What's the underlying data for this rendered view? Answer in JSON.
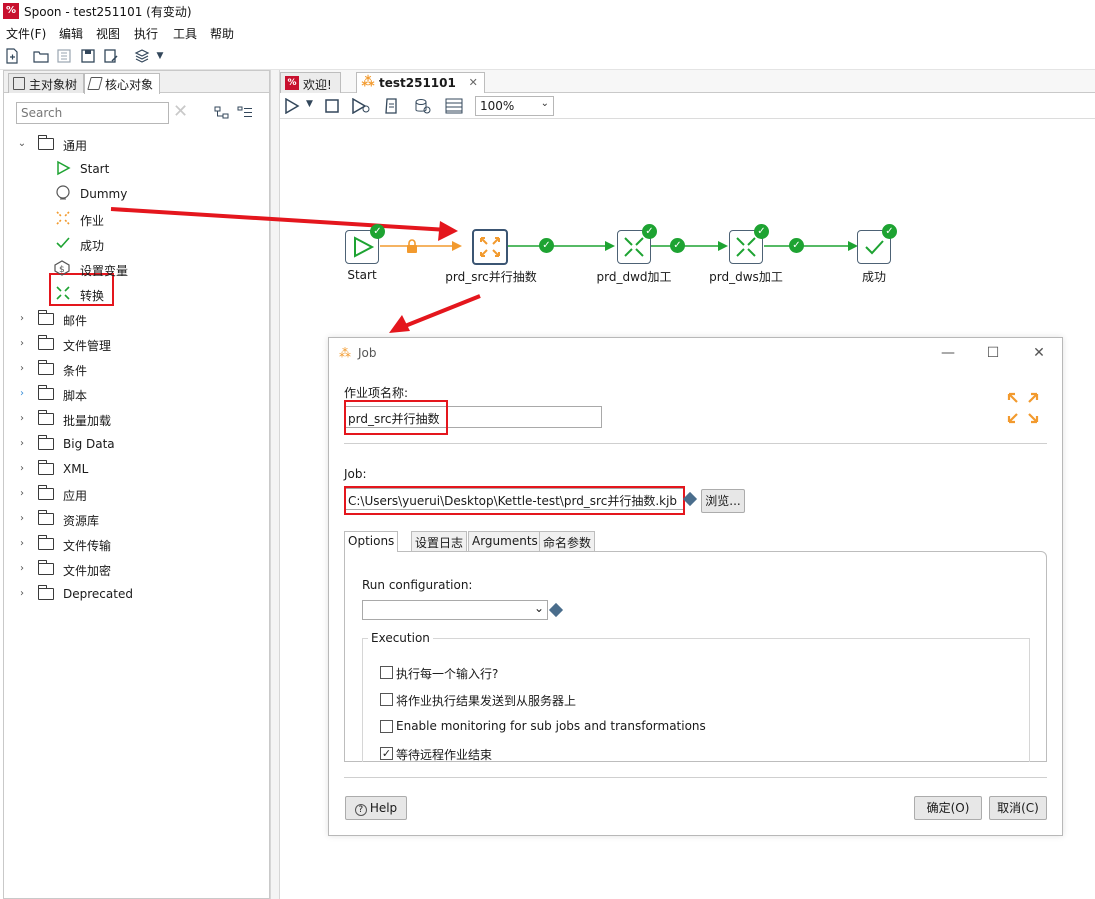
{
  "window": {
    "title": "Spoon - test251101 (有变动)"
  },
  "menu": [
    "文件(F)",
    "编辑",
    "视图",
    "执行",
    "工具",
    "帮助"
  ],
  "left_panel": {
    "tabs": [
      "主对象树",
      "核心对象"
    ],
    "search_placeholder": "Search",
    "tree": {
      "general_folder": "通用",
      "general_items": [
        {
          "label": "Start",
          "icon": "play-icon"
        },
        {
          "label": "Dummy",
          "icon": "dummy-icon"
        },
        {
          "label": "作业",
          "icon": "job-icon"
        },
        {
          "label": "成功",
          "icon": "check-icon"
        },
        {
          "label": "设置变量",
          "icon": "variable-icon"
        },
        {
          "label": "转换",
          "icon": "transform-icon"
        }
      ],
      "folders": [
        "邮件",
        "文件管理",
        "条件",
        "脚本",
        "批量加载",
        "Big Data",
        "XML",
        "应用",
        "资源库",
        "文件传输",
        "文件加密",
        "Deprecated"
      ]
    }
  },
  "editor": {
    "tabs": [
      "欢迎!",
      "test251101"
    ],
    "zoom": "100%"
  },
  "job_canvas": {
    "nodes": [
      {
        "label": "Start",
        "icon": "play-icon"
      },
      {
        "label": "prd_src并行抽数",
        "icon": "job-icon"
      },
      {
        "label": "prd_dwd加工",
        "icon": "transform-icon"
      },
      {
        "label": "prd_dws加工",
        "icon": "transform-icon"
      },
      {
        "label": "成功",
        "icon": "check-icon"
      }
    ]
  },
  "dialog": {
    "title": "Job",
    "name_label": "作业项名称:",
    "name_value": "prd_src并行抽数",
    "job_label": "Job:",
    "job_path": "C:\\Users\\yuerui\\Desktop\\Kettle-test\\prd_src并行抽数.kjb",
    "browse_button": "浏览...",
    "tabs": [
      "Options",
      "设置日志",
      "Arguments",
      "命名参数"
    ],
    "run_config_label": "Run configuration:",
    "run_config_value": "",
    "execution_group": "Execution",
    "options": [
      {
        "label": "执行每一个输入行?",
        "checked": false
      },
      {
        "label": "将作业执行结果发送到从服务器上",
        "checked": false
      },
      {
        "label": "Enable monitoring for sub jobs and transformations",
        "checked": false
      },
      {
        "label": "等待远程作业结束",
        "checked": true
      }
    ],
    "help_button": "Help",
    "ok_button": "确定(O)",
    "cancel_button": "取消(C)"
  },
  "colors": {
    "accent_red": "#e4161d",
    "hop_green": "#1ea332",
    "job_orange": "#f29a2e",
    "node_border": "#4d6275"
  }
}
